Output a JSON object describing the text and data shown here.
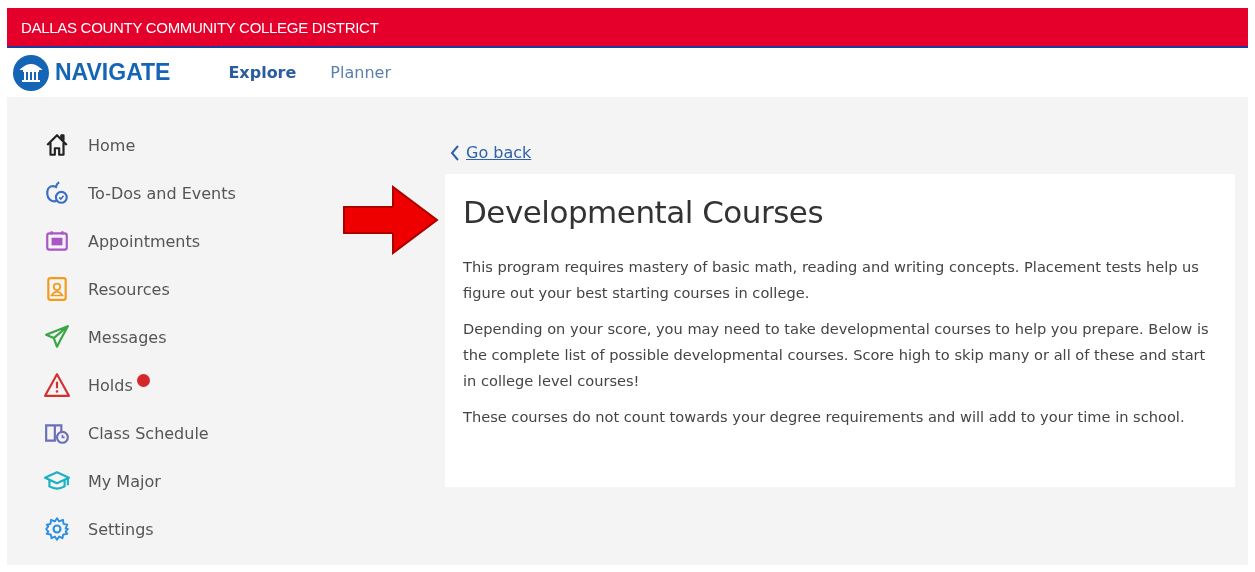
{
  "header": {
    "title": "DALLAS COUNTY COMMUNITY COLLEGE DISTRICT"
  },
  "navbar": {
    "logo": "NAVIGATE",
    "tabs": [
      {
        "label": "Explore",
        "selected": true
      },
      {
        "label": "Planner",
        "selected": false
      }
    ]
  },
  "sidebar": {
    "items": [
      {
        "kind": "home",
        "label": "Home",
        "alert": false
      },
      {
        "kind": "todo",
        "label": "To-Dos and Events",
        "alert": false
      },
      {
        "kind": "calendar",
        "label": "Appointments",
        "alert": false
      },
      {
        "kind": "resource",
        "label": "Resources",
        "alert": false
      },
      {
        "kind": "message",
        "label": "Messages",
        "alert": false
      },
      {
        "kind": "warning",
        "label": "Holds",
        "alert": true
      },
      {
        "kind": "schedule",
        "label": "Class Schedule",
        "alert": false
      },
      {
        "kind": "major",
        "label": "My Major",
        "alert": false
      },
      {
        "kind": "settings",
        "label": "Settings",
        "alert": false
      }
    ]
  },
  "main": {
    "back_link": "Go back",
    "title": "Developmental Courses",
    "paragraphs": [
      "This program requires mastery of basic math, reading and writing concepts. Placement tests help us figure out your best starting courses in college.",
      "Depending on your score, you may need to take developmental courses to help you prepare. Below is the complete list of possible developmental courses. Score high to skip many or all of these and start in college level courses!",
      "These courses do not count towards your degree requirements and will add to your time in school."
    ]
  }
}
